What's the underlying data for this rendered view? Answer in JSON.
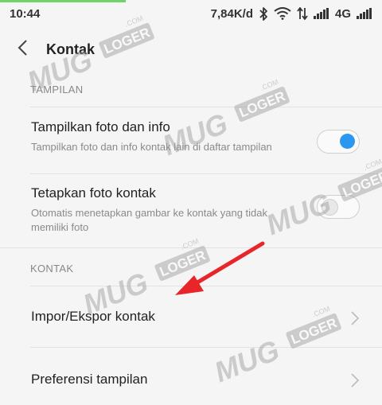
{
  "status_bar": {
    "time": "10:44",
    "speed": "7,84K/d",
    "network_type": "4G",
    "icons": [
      "bluetooth-icon",
      "wifi-icon",
      "data-arrows-icon",
      "signal-icon",
      "signal-icon"
    ]
  },
  "header": {
    "title": "Kontak",
    "back_icon": "chevron-left-icon"
  },
  "sections": {
    "tampilan": {
      "label": "TAMPILAN",
      "items": [
        {
          "title": "Tampilkan foto dan info",
          "subtitle": "Tampilkan foto dan info kontak lain di daftar tampilan",
          "toggle": "on"
        },
        {
          "title": "Tetapkan foto kontak",
          "subtitle": "Otomatis menetapkan gambar ke kontak yang tidak memiliki foto",
          "toggle": "off"
        }
      ]
    },
    "kontak": {
      "label": "KONTAK",
      "items": [
        {
          "title": "Impor/Ekspor kontak",
          "icon": "chevron-right-icon"
        },
        {
          "title": "Preferensi tampilan",
          "icon": "chevron-right-icon"
        }
      ]
    }
  },
  "watermark": {
    "text_main": "MUG",
    "text_badge": "LOGER",
    "text_com": ".COM"
  },
  "colors": {
    "accent": "#2b97f0",
    "arrow": "#e8262a",
    "background": "#f5f5f5"
  }
}
